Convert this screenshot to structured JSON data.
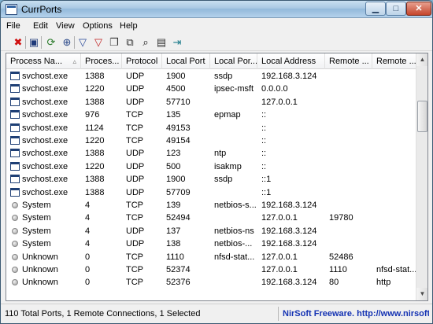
{
  "window": {
    "title": "CurrPorts"
  },
  "menu": [
    "File",
    "Edit",
    "View",
    "Options",
    "Help"
  ],
  "toolbar": [
    {
      "name": "close-ports-icon",
      "glyph": "✖",
      "color": "#d01010"
    },
    {
      "name": "save-icon",
      "glyph": "▣",
      "color": "#1f3a7a"
    },
    {
      "name": "refresh-icon",
      "glyph": "⟳",
      "color": "#2a7a2a"
    },
    {
      "name": "properties-icon",
      "glyph": "⊕",
      "color": "#2c4a8a"
    },
    {
      "name": "filter-icon",
      "glyph": "▽",
      "color": "#2a4a9a"
    },
    {
      "name": "filter-clear-icon",
      "glyph": "▽",
      "color": "#c02020"
    },
    {
      "name": "copy-icon",
      "glyph": "❐",
      "color": "#333"
    },
    {
      "name": "copy-selected-icon",
      "glyph": "⧉",
      "color": "#333"
    },
    {
      "name": "find-icon",
      "glyph": "⌕",
      "color": "#111"
    },
    {
      "name": "html-report-icon",
      "glyph": "▤",
      "color": "#333"
    },
    {
      "name": "exit-icon",
      "glyph": "⇥",
      "color": "#1a7a8a"
    }
  ],
  "columns": [
    "Process Na...",
    "Proces...",
    "Protocol",
    "Local Port",
    "Local Por...",
    "Local Address",
    "Remote ...",
    "Remote ..."
  ],
  "rows": [
    {
      "icon": "win",
      "proc": "svchost.exe",
      "pid": "1388",
      "proto": "UDP",
      "lport": "1900",
      "lportname": "ssdp",
      "laddr": "192.168.3.124",
      "rport": "",
      "rportname": ""
    },
    {
      "icon": "win",
      "proc": "svchost.exe",
      "pid": "1220",
      "proto": "UDP",
      "lport": "4500",
      "lportname": "ipsec-msft",
      "laddr": "0.0.0.0",
      "rport": "",
      "rportname": ""
    },
    {
      "icon": "win",
      "proc": "svchost.exe",
      "pid": "1388",
      "proto": "UDP",
      "lport": "57710",
      "lportname": "",
      "laddr": "127.0.0.1",
      "rport": "",
      "rportname": ""
    },
    {
      "icon": "win",
      "proc": "svchost.exe",
      "pid": "976",
      "proto": "TCP",
      "lport": "135",
      "lportname": "epmap",
      "laddr": "::",
      "rport": "",
      "rportname": ""
    },
    {
      "icon": "win",
      "proc": "svchost.exe",
      "pid": "1124",
      "proto": "TCP",
      "lport": "49153",
      "lportname": "",
      "laddr": "::",
      "rport": "",
      "rportname": ""
    },
    {
      "icon": "win",
      "proc": "svchost.exe",
      "pid": "1220",
      "proto": "TCP",
      "lport": "49154",
      "lportname": "",
      "laddr": "::",
      "rport": "",
      "rportname": ""
    },
    {
      "icon": "win",
      "proc": "svchost.exe",
      "pid": "1388",
      "proto": "UDP",
      "lport": "123",
      "lportname": "ntp",
      "laddr": "::",
      "rport": "",
      "rportname": ""
    },
    {
      "icon": "win",
      "proc": "svchost.exe",
      "pid": "1220",
      "proto": "UDP",
      "lport": "500",
      "lportname": "isakmp",
      "laddr": "::",
      "rport": "",
      "rportname": ""
    },
    {
      "icon": "win",
      "proc": "svchost.exe",
      "pid": "1388",
      "proto": "UDP",
      "lport": "1900",
      "lportname": "ssdp",
      "laddr": "::1",
      "rport": "",
      "rportname": ""
    },
    {
      "icon": "win",
      "proc": "svchost.exe",
      "pid": "1388",
      "proto": "UDP",
      "lport": "57709",
      "lportname": "",
      "laddr": "::1",
      "rport": "",
      "rportname": ""
    },
    {
      "icon": "dot",
      "proc": "System",
      "pid": "4",
      "proto": "TCP",
      "lport": "139",
      "lportname": "netbios-s...",
      "laddr": "192.168.3.124",
      "rport": "",
      "rportname": ""
    },
    {
      "icon": "dot",
      "proc": "System",
      "pid": "4",
      "proto": "TCP",
      "lport": "52494",
      "lportname": "",
      "laddr": "127.0.0.1",
      "rport": "19780",
      "rportname": ""
    },
    {
      "icon": "dot",
      "proc": "System",
      "pid": "4",
      "proto": "UDP",
      "lport": "137",
      "lportname": "netbios-ns",
      "laddr": "192.168.3.124",
      "rport": "",
      "rportname": ""
    },
    {
      "icon": "dot",
      "proc": "System",
      "pid": "4",
      "proto": "UDP",
      "lport": "138",
      "lportname": "netbios-...",
      "laddr": "192.168.3.124",
      "rport": "",
      "rportname": ""
    },
    {
      "icon": "dot",
      "proc": "Unknown",
      "pid": "0",
      "proto": "TCP",
      "lport": "1110",
      "lportname": "nfsd-stat...",
      "laddr": "127.0.0.1",
      "rport": "52486",
      "rportname": ""
    },
    {
      "icon": "dot",
      "proc": "Unknown",
      "pid": "0",
      "proto": "TCP",
      "lport": "52374",
      "lportname": "",
      "laddr": "127.0.0.1",
      "rport": "1110",
      "rportname": "nfsd-stat..."
    },
    {
      "icon": "dot",
      "proc": "Unknown",
      "pid": "0",
      "proto": "TCP",
      "lport": "52376",
      "lportname": "",
      "laddr": "192.168.3.124",
      "rport": "80",
      "rportname": "http"
    }
  ],
  "status": {
    "summary": "110 Total Ports, 1 Remote Connections, 1 Selected",
    "credit": "NirSoft Freeware.  http://www.nirsoft.net"
  }
}
